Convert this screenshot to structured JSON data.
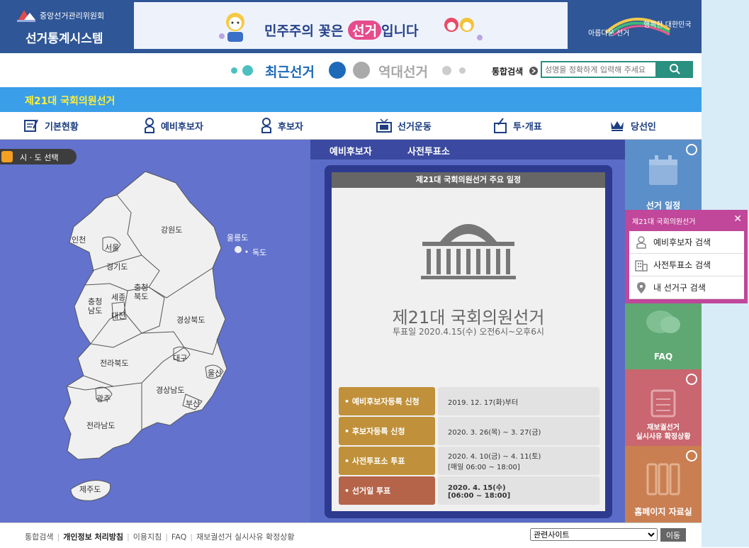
{
  "header": {
    "org_name": "중앙선거관리위원회",
    "system_name": "선거통계시스템",
    "banner_text_pre": "민주주의 꽃은 ",
    "banner_text_highlight": "선거",
    "banner_text_post": "입니다",
    "slogan_left": "아름다운 선거",
    "slogan_right": "행복한 대한민국"
  },
  "switcher": {
    "recent_label": "최근선거",
    "history_label": "역대선거",
    "search_label": "통합검색",
    "search_placeholder": "성명을 정확하게 입력해 주세요"
  },
  "title": "제21대 국회의원선거",
  "menu": [
    {
      "label": "기본현황",
      "icon": "document-icon"
    },
    {
      "label": "예비후보자",
      "icon": "person-icon"
    },
    {
      "label": "후보자",
      "icon": "person-icon"
    },
    {
      "label": "선거운동",
      "icon": "tv-icon"
    },
    {
      "label": "투·개표",
      "icon": "ballot-icon"
    },
    {
      "label": "당선인",
      "icon": "crown-icon"
    }
  ],
  "map": {
    "select_label": "시 · 도 선택",
    "regions": [
      "인천",
      "서울",
      "경기도",
      "강원도",
      "울릉도",
      "독도",
      "충청남도",
      "세종",
      "충청북도",
      "대전",
      "경상북도",
      "대구",
      "울산",
      "전라북도",
      "경상남도",
      "광주",
      "부산",
      "전라남도",
      "제주도"
    ]
  },
  "center": {
    "tabs": [
      "예비후보자",
      "사전투표소"
    ],
    "schedule_title": "제21대 국회의원선거 주요 일정",
    "big_title": "제21대 국회의원선거",
    "vote_date": "투표일 2020.4.15(수) 오전6시~오후6시",
    "schedule": [
      {
        "label": "• 예비후보자등록 신청",
        "value": "2019. 12. 17(화)부터",
        "color": "#c0913a"
      },
      {
        "label": "• 후보자등록 신청",
        "value": "2020. 3. 26(목) ~ 3. 27(금)",
        "color": "#c0913a"
      },
      {
        "label": "• 사전투표소 투표",
        "value": "2020. 4. 10(금) ~ 4. 11(토)\n[매일 06:00 ~ 18:00]",
        "color": "#c0913a"
      },
      {
        "label": "• 선거일 투표",
        "value": "2020. 4. 15(수)\n[06:00 ~ 18:00]",
        "color": "#b5644a"
      }
    ]
  },
  "side": {
    "schedule": "선거 일정",
    "faq": "FAQ",
    "reelection": "재보궐선거\n실시사유 확정상황",
    "archive": "홈페이지 자료실"
  },
  "popup": {
    "title": "제21대 국회의원선거",
    "items": [
      "예비후보자 검색",
      "사전투표소 검색",
      "내 선거구 검색"
    ]
  },
  "footer": {
    "links": [
      "통합검색",
      "개인정보 처리방침",
      "이용지침",
      "FAQ",
      "재보궐선거 실시사유 확정상황"
    ],
    "related_sites": "관련사이트",
    "move_button": "이동"
  }
}
